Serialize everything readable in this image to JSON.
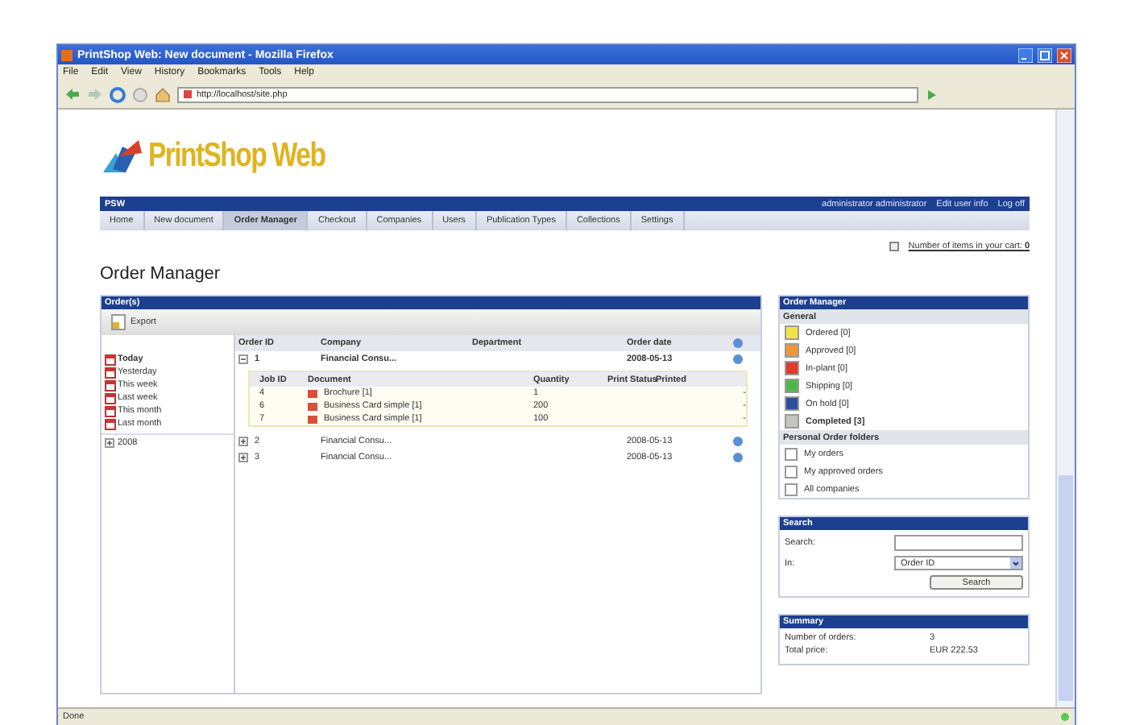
{
  "window": {
    "title": "PrintShop Web: New document - Mozilla Firefox"
  },
  "menu": [
    "File",
    "Edit",
    "View",
    "History",
    "Bookmarks",
    "Tools",
    "Help"
  ],
  "address": "http://localhost/site.php",
  "logo_text": "PrintShop Web",
  "top_bar": {
    "brand": "PSW",
    "user": "administrator administrator",
    "links": [
      "Edit user info",
      "Log off"
    ]
  },
  "tabs": [
    {
      "label": "Home",
      "selected": false
    },
    {
      "label": "New document",
      "selected": false
    },
    {
      "label": "Order Manager",
      "selected": true
    },
    {
      "label": "Checkout",
      "selected": false
    },
    {
      "label": "Companies",
      "selected": false
    },
    {
      "label": "Users",
      "selected": false
    },
    {
      "label": "Publication Types",
      "selected": false
    },
    {
      "label": "Collections",
      "selected": false
    },
    {
      "label": "Settings",
      "selected": false
    }
  ],
  "cart": "Number of items in your cart: **0**",
  "page_title": "Order Manager",
  "orders": {
    "title": "Order(s)",
    "export": "Export",
    "periods": [
      {
        "label": "Today",
        "selected": true
      },
      {
        "label": "Yesterday",
        "selected": false
      },
      {
        "label": "This week",
        "selected": false
      },
      {
        "label": "Last week",
        "selected": false
      },
      {
        "label": "This month",
        "selected": false
      },
      {
        "label": "Last month",
        "selected": false
      }
    ],
    "years": [
      {
        "label": "2008",
        "expanded": false
      }
    ],
    "columns": [
      "Order ID",
      "Company",
      "Department",
      "Order date"
    ],
    "rows": [
      {
        "id": "1",
        "company": "Financial Consu...",
        "date": "2008-05-13",
        "expanded": true,
        "selected": true,
        "jobs": {
          "columns": [
            "Job ID",
            "Document",
            "Quantity",
            "Print Status",
            "Printed"
          ],
          "rows": [
            {
              "id": "4",
              "document": "Brochure [1]",
              "quantity": "1",
              "status": "",
              "printed": "-"
            },
            {
              "id": "6",
              "document": "Business Card simple [1]",
              "quantity": "200",
              "status": "",
              "printed": "-"
            },
            {
              "id": "7",
              "document": "Business Card simple [1]",
              "quantity": "100",
              "status": "",
              "printed": "-"
            }
          ]
        }
      },
      {
        "id": "2",
        "company": "Financial Consu...",
        "date": "2008-05-13",
        "expanded": false,
        "selected": false
      },
      {
        "id": "3",
        "company": "Financial Consu...",
        "date": "2008-05-13",
        "expanded": false,
        "selected": false
      }
    ]
  },
  "side": {
    "title": "Order Manager",
    "general": "General",
    "statuses": [
      {
        "label": "Ordered [0]",
        "color": "#f2e341",
        "selected": false
      },
      {
        "label": "Approved [0]",
        "color": "#f0963a",
        "selected": false
      },
      {
        "label": "In-plant [0]",
        "color": "#e03a2a",
        "selected": false
      },
      {
        "label": "Shipping [0]",
        "color": "#4cb84a",
        "selected": false
      },
      {
        "label": "On hold [0]",
        "color": "#2a4f9c",
        "selected": false
      },
      {
        "label": "Completed [3]",
        "color": "#c4c4c0",
        "selected": true
      }
    ],
    "folders_title": "Personal Order folders",
    "folders": [
      {
        "label": "My orders",
        "checked": false
      },
      {
        "label": "My approved orders",
        "checked": false
      },
      {
        "label": "All companies",
        "checked": false
      }
    ]
  },
  "search": {
    "title": "Search",
    "search_label": "Search:",
    "in_label": "In:",
    "in_value": "Order ID",
    "button": "Search"
  },
  "summary": {
    "title": "Summary",
    "rows": [
      {
        "label": "Number of orders:",
        "value": "3"
      },
      {
        "label": "Total price:",
        "value": "EUR 222.53"
      }
    ]
  },
  "status_bar": "Done"
}
